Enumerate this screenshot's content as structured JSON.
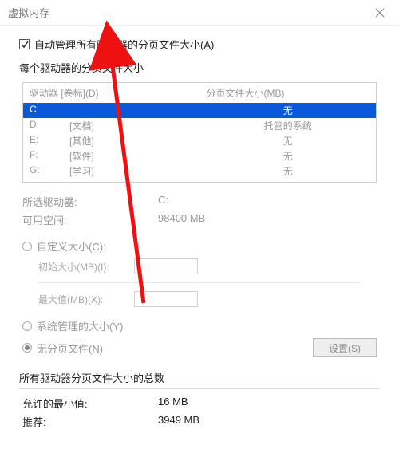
{
  "window": {
    "title": "虚拟内存"
  },
  "autoManage": {
    "label": "自动管理所有驱动器的分页文件大小(A)",
    "checked": true
  },
  "perDrive": {
    "label": "每个驱动器的分页文件大小",
    "header_drive": "驱动器 [卷标](D)",
    "header_size": "分页文件大小(MB)",
    "rows": [
      {
        "letter": "C:",
        "label": "",
        "size": "无",
        "selected": true
      },
      {
        "letter": "D:",
        "label": "[文档]",
        "size": "托管的系统",
        "selected": false
      },
      {
        "letter": "E:",
        "label": "[其他]",
        "size": "无",
        "selected": false
      },
      {
        "letter": "F:",
        "label": "[软件]",
        "size": "无",
        "selected": false
      },
      {
        "letter": "G:",
        "label": "[学习]",
        "size": "无",
        "selected": false
      }
    ]
  },
  "driveInfo": {
    "selected_label": "所选驱动器:",
    "selected_value": "C:",
    "free_label": "可用空间:",
    "free_value": "98400 MB"
  },
  "options": {
    "custom_label": "自定义大小(C):",
    "initial_label": "初始大小(MB)(I):",
    "max_label": "最大值(MB)(X):",
    "system_label": "系统管理的大小(Y)",
    "none_label": "无分页文件(N)",
    "set_button": "设置(S)"
  },
  "totals": {
    "group_label": "所有驱动器分页文件大小的总数",
    "min_label": "允许的最小值:",
    "min_value": "16 MB",
    "rec_label": "推荐:",
    "rec_value": "3949 MB"
  }
}
